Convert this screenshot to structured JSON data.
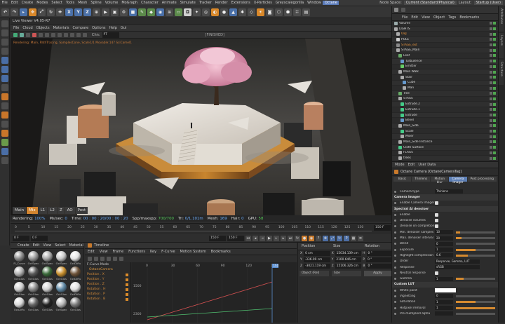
{
  "menubar": {
    "items": [
      "File",
      "Edit",
      "Create",
      "Modes",
      "Select",
      "Tools",
      "Mesh",
      "Spline",
      "Volume",
      "MoGraph",
      "Character",
      "Animate",
      "Simulate",
      "Tracker",
      "Render",
      "Extensions",
      "X-Particles",
      "Greyscalegorilla",
      "Window",
      "Octane"
    ],
    "highlighted": "Octane",
    "node_space_label": "Node Space:",
    "node_space_value": "Current (Standard/Physical)",
    "layout_label": "Layout:",
    "layout_value": "Startup (User)"
  },
  "toolbar": {
    "axis_buttons": [
      "X",
      "Y",
      "Z"
    ]
  },
  "live_viewer": {
    "title": "Live Viewer V4.05-R7",
    "menu": [
      "File",
      "Cloud",
      "Objects",
      "Materials",
      "Compare",
      "Options",
      "Help",
      "Gui"
    ],
    "tool_label": "Chn:",
    "tool_value": "PT",
    "status_text": "[FINISHED]",
    "overlay_text": "Rendering: Main, PathTracing, SamplesCone, Scale1/1 Movable:147 SciCamel1",
    "tabs": [
      "Main",
      "Mix",
      "L1",
      "L2",
      "Z",
      "AO",
      "Post"
    ],
    "active_tab": "Mix"
  },
  "render_info": {
    "rendering_label": "Rendering:",
    "rendering_value": "100%",
    "ms_label": "Ms/sec:",
    "ms_value": "0",
    "time_label": "Time:",
    "time_value": "00 : 00 : 20/00 : 00 : 20",
    "spp_label": "Spp/maxspp:",
    "spp_value": "700/700",
    "tri_label": "Tri:",
    "tri_value": "0/1.101m",
    "mesh_label": "Mesh:",
    "mesh_value": "169",
    "hair_label": "Hair:",
    "hair_value": "0",
    "gpu_label": "GPU:",
    "gpu_value": "58"
  },
  "timeline_ruler": {
    "ticks": [
      "0",
      "5",
      "10",
      "15",
      "20",
      "25",
      "30",
      "35",
      "40",
      "45",
      "50",
      "55",
      "60",
      "65",
      "70",
      "75",
      "80",
      "85",
      "90",
      "95",
      "100",
      "105",
      "110",
      "115",
      "120",
      "125",
      "130"
    ],
    "end_value": "150 F"
  },
  "transport": {
    "start_field": "0 F",
    "current_field": "0 F",
    "end_field": "150 F",
    "max_field": "150 F"
  },
  "material_panel": {
    "menu": [
      "Create",
      "Edit",
      "View",
      "Select",
      "Material"
    ],
    "materials": [
      {
        "label": "Fl_Curve",
        "color": "#8a8a8a"
      },
      {
        "label": "OctSpec",
        "color": "#9a9a9a"
      },
      {
        "label": "OctSpec",
        "color": "#a8a8a8"
      },
      {
        "label": "OctSpec",
        "color": "#c8c8c8"
      },
      {
        "label": "OctDiffu",
        "color": "#e4e4e4"
      },
      {
        "label": "OctGlos",
        "color": "#b0b0b0"
      },
      {
        "label": "OctGlos",
        "color": "#5a5a5a"
      },
      {
        "label": "OctGlos",
        "color": "#3a6a3a"
      },
      {
        "label": "OctGlos",
        "color": "#c9902e"
      },
      {
        "label": "OctDiffu",
        "color": "#6d5238"
      },
      {
        "label": "OctGlos",
        "color": "#cfcfcf"
      },
      {
        "label": "OctGlos",
        "color": "#8a8a8a"
      },
      {
        "label": "OctGlos",
        "color": "#d0d0d0"
      },
      {
        "label": "OctGlos",
        "color": "#5f88a4"
      },
      {
        "label": "OctDiffu",
        "color": "#e0e0e0"
      },
      {
        "label": "OctDiffu",
        "color": "#d8d8d8"
      },
      {
        "label": "OctGlos",
        "color": "#666666"
      },
      {
        "label": "OctGlos",
        "color": "#222222"
      },
      {
        "label": "OctSpec",
        "color": "#b9b9b9"
      },
      {
        "label": "OctGlos",
        "color": "#7a7a7a"
      }
    ]
  },
  "timeline_panel": {
    "title": "Timeline",
    "menu": [
      "Edit",
      "View",
      "Frame",
      "Functions",
      "Key",
      "F-Curve",
      "Motion System",
      "Bookmarks"
    ],
    "mode_label": "F-Curve Mode",
    "tracks": [
      {
        "label": "OctaneCamera",
        "type": "obj"
      },
      {
        "label": "Position . X",
        "type": "track"
      },
      {
        "label": "Position . Y",
        "type": "track"
      },
      {
        "label": "Position . Z",
        "type": "track"
      },
      {
        "label": "Rotation . H",
        "type": "track"
      },
      {
        "label": "Rotation . P",
        "type": "track"
      },
      {
        "label": "Rotation . B",
        "type": "track"
      }
    ],
    "graph_x_ticks": [
      "0",
      "30",
      "60",
      "90",
      "120",
      "150"
    ],
    "graph_y_ticks": [
      "1500",
      "2300"
    ],
    "current_frame_label": "150"
  },
  "coordinates": {
    "headers": [
      "Position",
      "Size",
      "Rotation"
    ],
    "rows": [
      {
        "axis": "X",
        "pos": "0 cm",
        "size_axis": "X",
        "size": "15034.139 cm",
        "rot_axis": "H",
        "rot": "0 °"
      },
      {
        "axis": "Y",
        "pos": "-336.09 cm",
        "size_axis": "Y",
        "size": "2100.646 cm",
        "rot_axis": "P",
        "rot": "0 °"
      },
      {
        "axis": "Z",
        "pos": "-3021.119 cm",
        "size_axis": "Z",
        "size": "15106.326 cm",
        "rot_axis": "B",
        "rot": "0 °"
      }
    ],
    "mode_dropdown": "Object (Rel)",
    "size_dropdown": "Size",
    "apply_label": "Apply"
  },
  "object_manager": {
    "menu": [
      "File",
      "Edit",
      "View",
      "Object",
      "Tags",
      "Bookmarks"
    ],
    "objects": [
      {
        "name": "Volume",
        "color": "#9aa",
        "orange": false,
        "checked": true
      },
      {
        "name": "LIGHTS",
        "color": "#aaa",
        "orange": false,
        "checked": true
      },
      {
        "name": "OBJ",
        "color": "#aaa",
        "orange": true,
        "checked": true
      },
      {
        "name": "POLE",
        "color": "#ccc",
        "orange": false,
        "checked": true
      },
      {
        "name": "STAGE_ext",
        "color": "#888",
        "orange": true,
        "checked": true
      },
      {
        "name": "STAGE_Main",
        "color": "#aaa",
        "orange": false,
        "checked": true
      },
      {
        "name": "Leaf",
        "color": "#6a6",
        "orange": false,
        "checked": true
      },
      {
        "name": "Turbulence",
        "color": "#69c",
        "orange": false,
        "checked": true
      },
      {
        "name": "Emitter",
        "color": "#6c6",
        "orange": false,
        "checked": true
      },
      {
        "name": "Main Walk",
        "color": "#aaa",
        "orange": false,
        "checked": true
      },
      {
        "name": "Stair",
        "color": "#aaa",
        "orange": false,
        "checked": true
      },
      {
        "name": "Cube",
        "color": "#69c",
        "orange": false,
        "checked": true
      },
      {
        "name": "Man",
        "color": "#aaa",
        "orange": false,
        "checked": true
      },
      {
        "name": "Tree",
        "color": "#6a6",
        "orange": false,
        "checked": true
      },
      {
        "name": "STAGE",
        "color": "#aaa",
        "orange": false,
        "checked": true
      },
      {
        "name": "Extrude.2",
        "color": "#4c8",
        "orange": false,
        "checked": true
      },
      {
        "name": "Extrude.1",
        "color": "#4c8",
        "orange": false,
        "checked": true
      },
      {
        "name": "Extrude",
        "color": "#4c8",
        "orange": false,
        "checked": true
      },
      {
        "name": "Bevel",
        "color": "#69c",
        "orange": false,
        "checked": true
      },
      {
        "name": "Main_Side",
        "color": "#aaa",
        "orange": false,
        "checked": true
      },
      {
        "name": "Scale",
        "color": "#4c8",
        "orange": false,
        "checked": true
      },
      {
        "name": "Mixer",
        "color": "#aaa",
        "orange": false,
        "checked": true
      },
      {
        "name": "Main_Side Instance",
        "color": "#aaa",
        "orange": false,
        "checked": true
      },
      {
        "name": "Cloth Surface",
        "color": "#4c8",
        "orange": false,
        "checked": true
      },
      {
        "name": "FLAGS",
        "color": "#aaa",
        "orange": false,
        "checked": true
      },
      {
        "name": "trees",
        "color": "#aaa",
        "orange": false,
        "checked": true
      }
    ]
  },
  "attributes": {
    "menu": [
      "Mode",
      "Edit",
      "User Data"
    ],
    "title": "Octane Camera [OctaneCameraTag]",
    "tabs": [
      "Basic",
      "Thinlens",
      "Motion blur",
      "Camera Imager"
    ],
    "active_tab": "Camera Imager",
    "tab2": "Post processing",
    "camera_type_label": "Camera type",
    "camera_type_value": "Thinlens",
    "rows": [
      {
        "type": "section",
        "label": "Camera Imager"
      },
      {
        "type": "check",
        "label": "Enable Camera Imager"
      },
      {
        "type": "section",
        "label": "Spectral AI denoiser"
      },
      {
        "type": "check",
        "label": "Enable"
      },
      {
        "type": "check",
        "label": "Denoise volumes"
      },
      {
        "type": "check",
        "label": "Denoise on completion"
      },
      {
        "type": "value",
        "label": "Min. denoiser samples",
        "value": "10",
        "fill": 0.1
      },
      {
        "type": "value",
        "label": "Max. denoiser interval",
        "value": "20",
        "fill": 0.15
      },
      {
        "type": "value",
        "label": "Blend",
        "value": "0",
        "fill": 0
      },
      {
        "type": "value",
        "label": "Exposure",
        "value": "1",
        "fill": 0.5
      },
      {
        "type": "value",
        "label": "Highlight compression",
        "value": "0.6",
        "fill": 0.3
      },
      {
        "type": "wide",
        "label": "Order",
        "value": "Response, Gamma, LUT"
      },
      {
        "type": "wide",
        "label": "Response",
        "value": "sRGB"
      },
      {
        "type": "check",
        "label": "Neutral response"
      },
      {
        "type": "value",
        "label": "Gamma",
        "value": "1",
        "fill": 0.2
      },
      {
        "type": "section",
        "label": "Custom LUT"
      },
      {
        "type": "color",
        "label": "White point"
      },
      {
        "type": "value",
        "label": "Vignetting",
        "value": "0",
        "fill": 0
      },
      {
        "type": "value",
        "label": "Saturation",
        "value": "1",
        "fill": 0.5
      },
      {
        "type": "value",
        "label": "Hotpixel removal",
        "value": "1",
        "fill": 1
      },
      {
        "type": "value",
        "label": "Pre-multiplied alpha",
        "value": "",
        "fill": 0
      }
    ]
  },
  "side_tabs": [
    "Attributes",
    "Layers",
    "Structure"
  ]
}
